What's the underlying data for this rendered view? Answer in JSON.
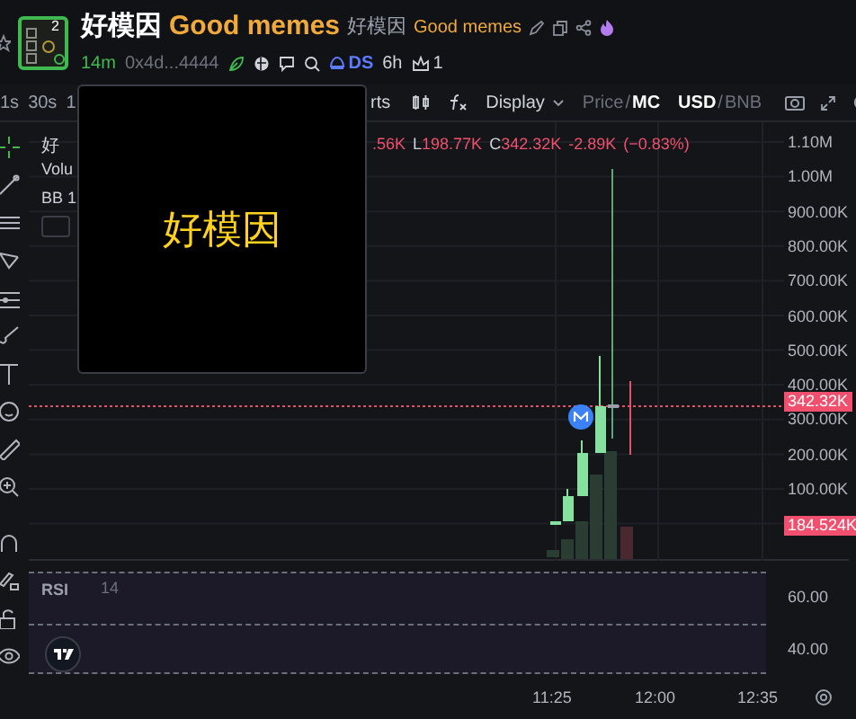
{
  "header": {
    "logo_badge": "2",
    "title": "好模因",
    "name": "Good memes",
    "alt_title": "好模因",
    "alt_name": "Good memes",
    "age": "14m",
    "address": "0x4d...4444",
    "ds_label": "DS",
    "ds_time": "6h",
    "holders_count": "1"
  },
  "toolbar": {
    "intervals": [
      "1s",
      "30s",
      "1"
    ],
    "cut_label": "rts",
    "display": "Display",
    "separator": "/",
    "price_toggle": [
      {
        "label": "Price",
        "selected": false
      },
      {
        "label": "MC",
        "selected": true
      }
    ],
    "currency_toggle": [
      {
        "label": "USD",
        "selected": true
      },
      {
        "label": "BNB",
        "selected": false
      }
    ]
  },
  "legend": {
    "symbol": "好",
    "volume": "Volu",
    "bb": "BB 1",
    "values": [
      {
        "value": ".56K"
      },
      {
        "label": "L",
        "value": "198.77K"
      },
      {
        "label": "C",
        "value": "342.32K"
      }
    ],
    "change": "-2.89K",
    "change_pct": "(−0.83%)"
  },
  "price_axis": {
    "ticks": [
      "1.10M",
      "1.00M",
      "900.00K",
      "800.00K",
      "700.00K",
      "600.00K",
      "500.00K",
      "400.00K",
      "300.00K",
      "200.00K",
      "100.00K"
    ],
    "current_price": "342.32K",
    "volume_value": "184.524K"
  },
  "rsi": {
    "label": "RSI",
    "period": "14",
    "ticks": [
      "60.00",
      "40.00"
    ]
  },
  "time_axis": [
    "11:25",
    "12:00",
    "12:35"
  ],
  "popup": {
    "text": "好模因"
  }
}
